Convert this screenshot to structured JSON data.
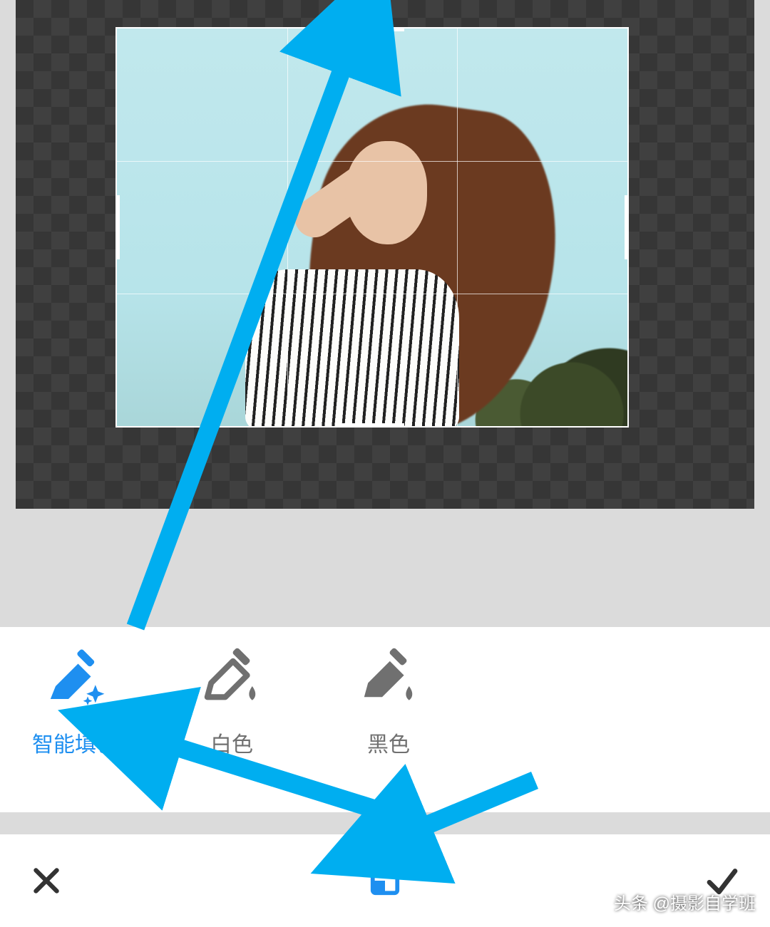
{
  "colors": {
    "accent": "#1e8ff0",
    "annotation": "#00aef0",
    "inactive": "#707070"
  },
  "fill_options": [
    {
      "id": "smart",
      "label": "智能填色",
      "icon": "paint-sparkle",
      "active": true
    },
    {
      "id": "white",
      "label": "白色",
      "icon": "paint-drop",
      "active": false
    },
    {
      "id": "black",
      "label": "黑色",
      "icon": "paint-drop",
      "active": false
    }
  ],
  "bottom_bar": {
    "cancel_icon": "close",
    "center_icon": "crop-expand",
    "confirm_icon": "check"
  },
  "watermark": "头条 @摄影自学班"
}
